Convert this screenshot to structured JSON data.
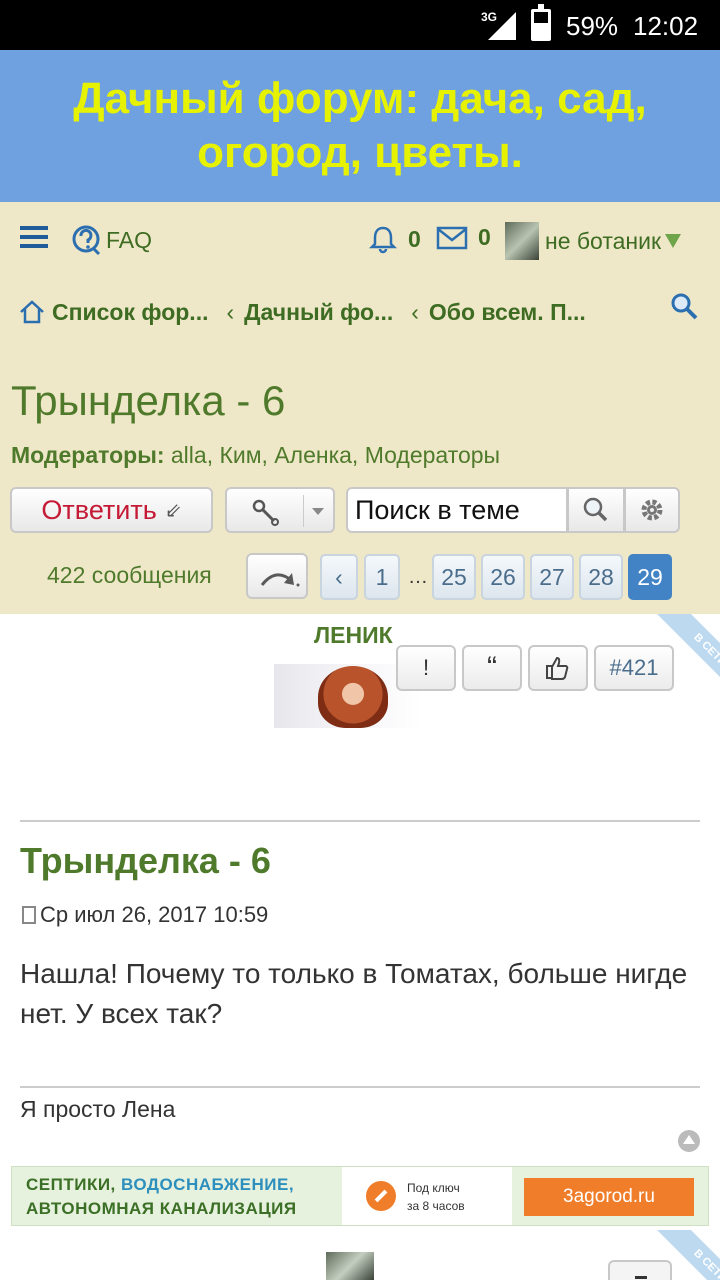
{
  "status_bar": {
    "network": "3G",
    "battery_percent": "59%",
    "battery_level": 0.59,
    "time": "12:02"
  },
  "banner": {
    "title": "Дачный форум: дача, сад, огород, цветы."
  },
  "navbar": {
    "faq_label": "FAQ",
    "notifications_count": "0",
    "messages_count": "0",
    "username": "не ботаник"
  },
  "breadcrumbs": [
    "Список фор...",
    "Дачный фо...",
    "Обо всем. П..."
  ],
  "topic": {
    "title": "Трынделка - 6",
    "moderators_label": "Модераторы:",
    "moderators": "alla, Ким, Аленка, Модераторы"
  },
  "actions": {
    "reply_label": "Ответить",
    "search_placeholder": "Поиск в теме…",
    "search_value": "Поиск в теме"
  },
  "pagination": {
    "count_label": "422 сообщения",
    "prev": "‹",
    "pages": [
      "1",
      "25",
      "26",
      "27",
      "28",
      "29"
    ],
    "ellipsis": "…",
    "current": "29"
  },
  "post": {
    "online_label": "В СЕТИ",
    "author": "ЛЕНИК",
    "report_label": "!",
    "quote_label": "“",
    "post_number": "#421",
    "title": "Трынделка - 6",
    "date": "Ср июл 26, 2017 10:59",
    "body": "Нашла! Почему то только в Томатах, больше нигде нет. У всех так?",
    "signature": "Я просто Лена"
  },
  "ad": {
    "line1_part1": "СЕПТИКИ, ",
    "line1_part2": "ВОДОСНАБЖЕНИЕ,",
    "line2": "АВТОНОМНАЯ КАНАЛИЗАЦИЯ",
    "mid_line1": "Под ключ",
    "mid_line2": "за 8 часов",
    "cta": "3agorod.ru"
  },
  "next_post": {
    "online_label": "В СЕТИ"
  }
}
